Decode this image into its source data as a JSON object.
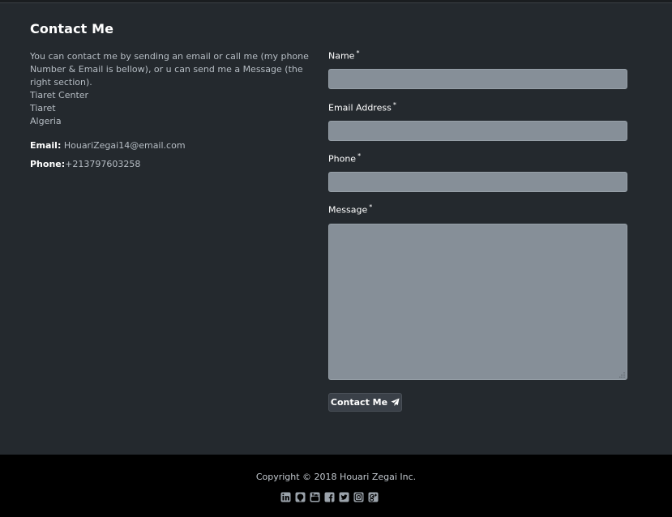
{
  "contact": {
    "title": "Contact Me",
    "intro": "You can contact me by sending an email or call me (my phone Number & Email is bellow), or u can send me a Message (the right section).",
    "address": [
      "Tiaret Center",
      "Tiaret",
      "Algeria"
    ],
    "email_label": "Email:",
    "email_value": " HouariZegai14@email.com",
    "phone_label": "Phone:",
    "phone_value": "+213797603258"
  },
  "form": {
    "name_label": "Name",
    "email_label": "Email Address",
    "phone_label": "Phone",
    "message_label": "Message",
    "required_mark": "*",
    "submit_label": "Contact Me"
  },
  "footer": {
    "copyright": "Copyright © 2018 Houari Zegai Inc.",
    "social_icons": [
      "linkedin-icon",
      "github-icon",
      "youtube-icon",
      "facebook-icon",
      "twitter-icon",
      "instagram-icon",
      "google-plus-icon"
    ]
  },
  "colors": {
    "background": "#24292e",
    "footer": "#000000",
    "input": "#868f98",
    "button": "#3a4048"
  }
}
